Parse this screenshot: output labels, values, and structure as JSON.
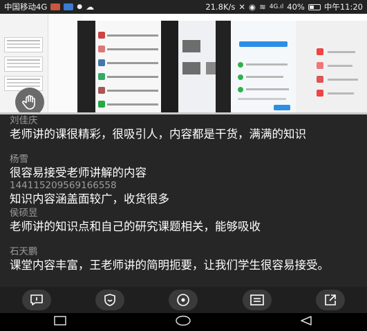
{
  "status_bar": {
    "carrier": "中国移动4G",
    "speed": "21.8K/s",
    "signal": "4G",
    "battery": "40%",
    "time": "中午11:20"
  },
  "comments": [
    {
      "user": "刘佳庆",
      "text": "老师讲的课很精彩，很吸引人，内容都是干货，满满的知识"
    },
    {
      "user": "杨雪",
      "text": "很容易接受老师讲解的内容"
    },
    {
      "user": "14411520956916655​8",
      "text": "知识内容涵盖面较广，收货很多"
    },
    {
      "user": "侯硕昱",
      "text": "老师讲的知识点和自己的研究课题相关，能够吸收"
    },
    {
      "user": "石天鹏",
      "text": "课堂内容丰富，王老师讲的简明扼要，让我们学生很容易接受。"
    }
  ],
  "action_bar": {
    "icons": [
      "comment-icon",
      "like-icon",
      "view-icon",
      "notes-icon",
      "share-icon"
    ]
  },
  "nav_bar": {
    "icons": [
      "recent-apps-icon",
      "home-icon",
      "back-icon"
    ]
  },
  "colors": {
    "background": "#262626",
    "username": "#9c9c9c",
    "text": "#ffffff",
    "accent_blue": "#2d8ee6",
    "accent_green": "#2fb24c"
  }
}
